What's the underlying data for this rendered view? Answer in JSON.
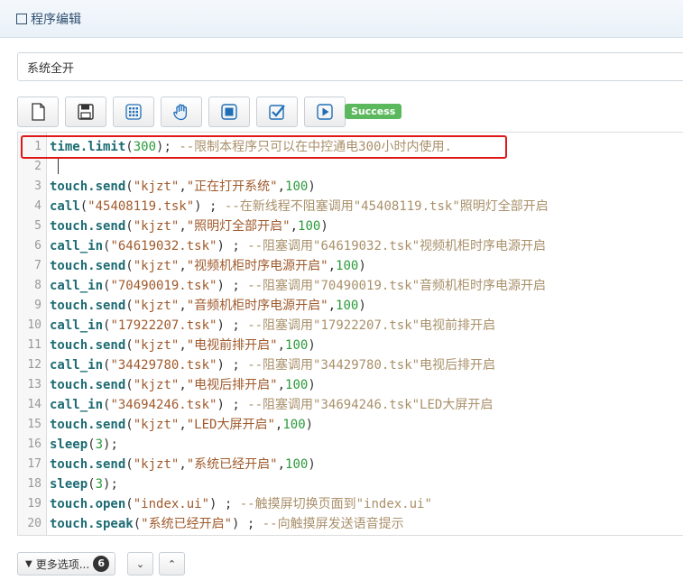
{
  "header": {
    "title": "程序编辑"
  },
  "name_field": {
    "value": "系统全开"
  },
  "toolbar": {
    "buttons": [
      "new-file-icon",
      "save-icon",
      "grid-icon",
      "hand-icon",
      "stop-icon",
      "check-icon",
      "play-icon"
    ],
    "status_badge": "Success",
    "status_color": "#5cb85c"
  },
  "editor": {
    "highlight_color": "#e01818",
    "lines": [
      {
        "n": "1",
        "code": "time.limit(300); --限制本程序只可以在中控通电300小时内使用."
      },
      {
        "n": "2",
        "code": ""
      },
      {
        "n": "3",
        "code": "touch.send(\"kjzt\",\"正在打开系统\",100)"
      },
      {
        "n": "4",
        "code": "call(\"45408119.tsk\") ; --在新线程不阻塞调用\"45408119.tsk\"照明灯全部开启"
      },
      {
        "n": "5",
        "code": "touch.send(\"kjzt\",\"照明灯全部开启\",100)"
      },
      {
        "n": "6",
        "code": "call_in(\"64619032.tsk\") ; --阻塞调用\"64619032.tsk\"视频机柜时序电源开启"
      },
      {
        "n": "7",
        "code": "touch.send(\"kjzt\",\"视频机柜时序电源开启\",100)"
      },
      {
        "n": "8",
        "code": "call_in(\"70490019.tsk\") ; --阻塞调用\"70490019.tsk\"音频机柜时序电源开启"
      },
      {
        "n": "9",
        "code": "touch.send(\"kjzt\",\"音频机柜时序电源开启\",100)"
      },
      {
        "n": "10",
        "code": "call_in(\"17922207.tsk\") ; --阻塞调用\"17922207.tsk\"电视前排开启"
      },
      {
        "n": "11",
        "code": "touch.send(\"kjzt\",\"电视前排开启\",100)"
      },
      {
        "n": "12",
        "code": "call_in(\"34429780.tsk\") ; --阻塞调用\"34429780.tsk\"电视后排开启"
      },
      {
        "n": "13",
        "code": "touch.send(\"kjzt\",\"电视后排开启\",100)"
      },
      {
        "n": "14",
        "code": "call_in(\"34694246.tsk\") ; --阻塞调用\"34694246.tsk\"LED大屏开启"
      },
      {
        "n": "15",
        "code": "touch.send(\"kjzt\",\"LED大屏开启\",100)"
      },
      {
        "n": "16",
        "code": "sleep(3);"
      },
      {
        "n": "17",
        "code": "touch.send(\"kjzt\",\"系统已经开启\",100)"
      },
      {
        "n": "18",
        "code": "sleep(3);"
      },
      {
        "n": "19",
        "code": "touch.open(\"index.ui\") ; --触摸屏切换页面到\"index.ui\""
      },
      {
        "n": "20",
        "code": "touch.speak(\"系统已经开启\") ; --向触摸屏发送语音提示"
      }
    ]
  },
  "footer": {
    "more_label": "更多选项...",
    "more_count": "6"
  }
}
